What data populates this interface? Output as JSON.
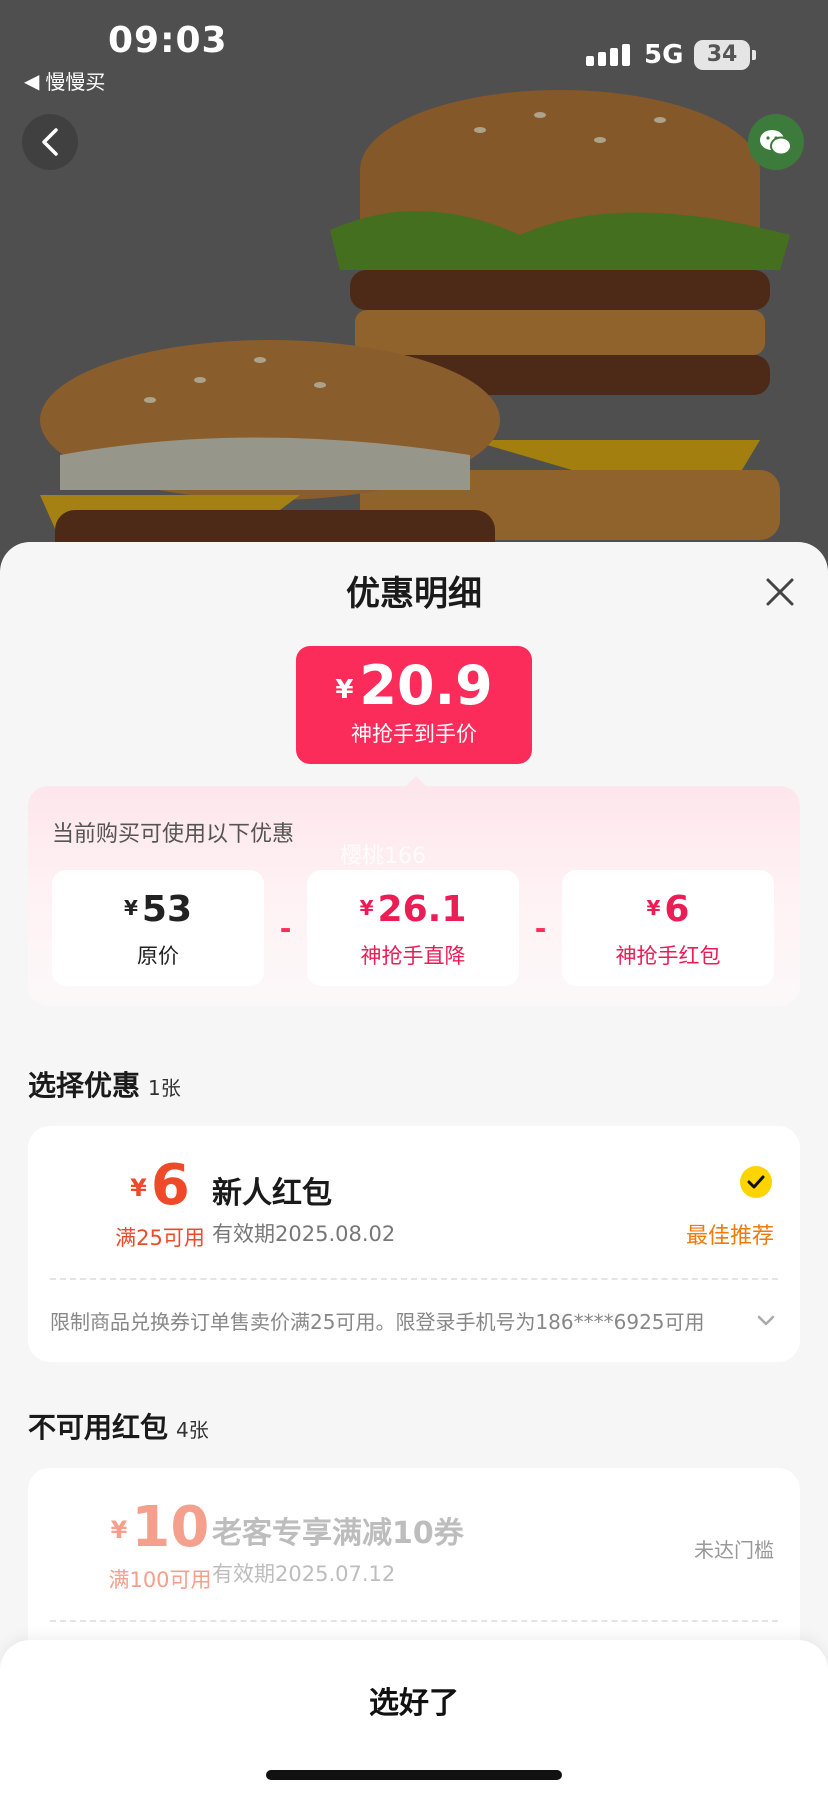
{
  "status_bar": {
    "time": "09:03",
    "back_app": "慢慢买",
    "network": "5G",
    "battery": "34"
  },
  "sheet": {
    "title": "优惠明细",
    "final_price": {
      "currency": "¥",
      "amount": "20.9",
      "label": "神抢手到手价"
    },
    "breakdown": {
      "title": "当前购买可使用以下优惠",
      "watermark": "樱桃166",
      "items": [
        {
          "currency": "¥",
          "value": "53",
          "label": "原价"
        },
        {
          "currency": "¥",
          "value": "26.1",
          "label": "神抢手直降"
        },
        {
          "currency": "¥",
          "value": "6",
          "label": "神抢手红包"
        }
      ],
      "operator": "-"
    },
    "select_section": {
      "title": "选择优惠",
      "count": "1张"
    },
    "available_coupon": {
      "currency": "¥",
      "amount": "6",
      "condition": "满25可用",
      "name": "新人红包",
      "validity": "有效期2025.08.02",
      "tag": "最佳推荐",
      "description": "限制商品兑换券订单售卖价满25可用。限登录手机号为186****6925可用"
    },
    "unavailable_section": {
      "title": "不可用红包",
      "count": "4张"
    },
    "unavailable_coupon": {
      "currency": "¥",
      "amount": "10",
      "condition": "满100可用",
      "name": "老客专享满减10券",
      "validity": "有效期2025.07.12",
      "status": "未达门槛"
    },
    "confirm_button": "选好了"
  },
  "colors": {
    "accent": "#fb2c5a",
    "coupon_orange": "#ee4a2a",
    "recommend": "#f07a0a",
    "check": "#ffd400"
  },
  "icons": [
    "back-arrow-icon",
    "wechat-icon",
    "close-icon",
    "check-icon",
    "chevron-down-icon"
  ]
}
